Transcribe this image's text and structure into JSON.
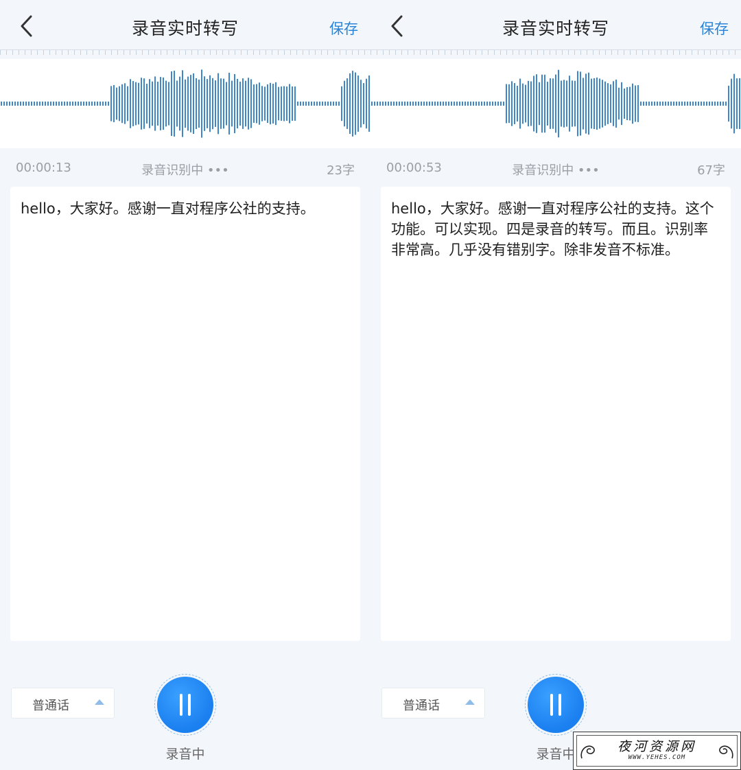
{
  "screens": [
    {
      "header": {
        "title": "录音实时转写",
        "save_label": "保存"
      },
      "status": {
        "time": "00:00:13",
        "state": "录音识别中 •••",
        "count": "23字"
      },
      "transcript": "hello，大家好。感谢一直对程序公社的支持。",
      "language": "普通话",
      "record_label": "录音中"
    },
    {
      "header": {
        "title": "录音实时转写",
        "save_label": "保存"
      },
      "status": {
        "time": "00:00:53",
        "state": "录音识别中 •••",
        "count": "67字"
      },
      "transcript": "hello，大家好。感谢一直对程序公社的支持。这个功能。可以实现。四是录音的转写。而且。识别率非常高。几乎没有错别字。除非发音不标准。",
      "language": "普通话",
      "record_label": "录音中"
    }
  ],
  "watermark": {
    "title": "夜河资源网",
    "url": "WWW.YEHES.COM"
  },
  "colors": {
    "accent": "#2a83d6",
    "wave": "#3d86c9",
    "background": "#f3f7fb"
  },
  "icons": [
    "back-arrow-icon",
    "pause-icon",
    "caret-up-icon"
  ]
}
